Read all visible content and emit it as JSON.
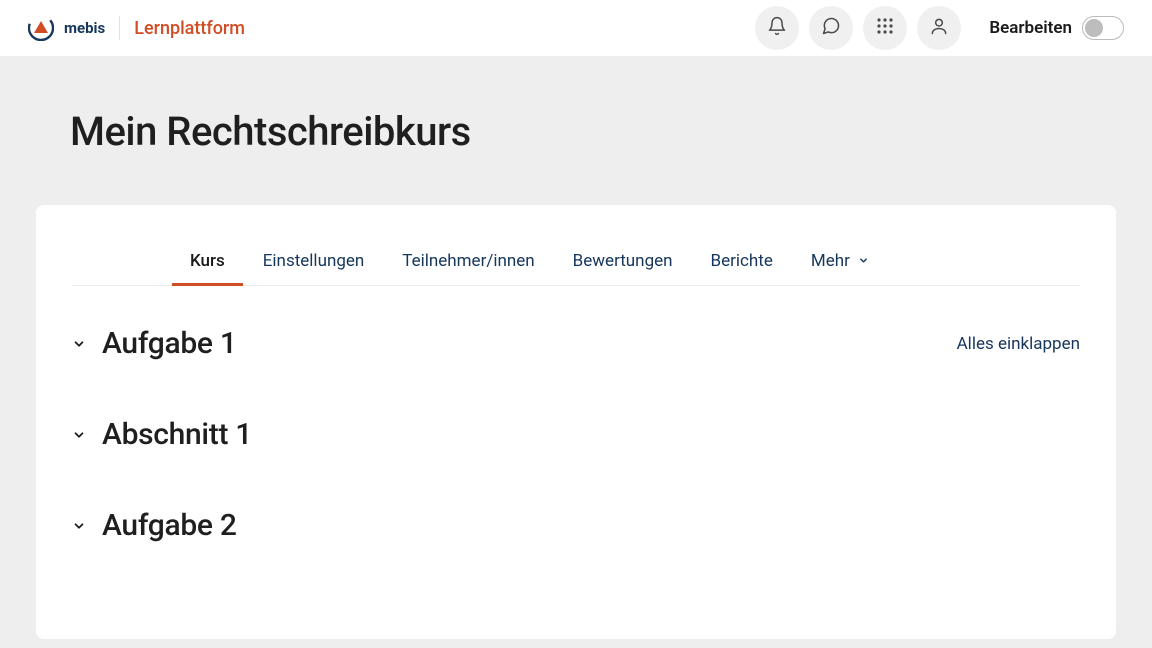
{
  "header": {
    "brand": "mebis",
    "platform": "Lernplattform",
    "edit_label": "Bearbeiten"
  },
  "page": {
    "title": "Mein Rechtschreibkurs"
  },
  "tabs": [
    {
      "label": "Kurs",
      "active": true
    },
    {
      "label": "Einstellungen",
      "active": false
    },
    {
      "label": "Teilnehmer/innen",
      "active": false
    },
    {
      "label": "Bewertungen",
      "active": false
    },
    {
      "label": "Berichte",
      "active": false
    },
    {
      "label": "Mehr",
      "active": false,
      "has_chevron": true
    }
  ],
  "collapse_all": "Alles einklappen",
  "sections": [
    {
      "title": "Aufgabe 1"
    },
    {
      "title": "Abschnitt 1"
    },
    {
      "title": "Aufgabe 2"
    }
  ]
}
